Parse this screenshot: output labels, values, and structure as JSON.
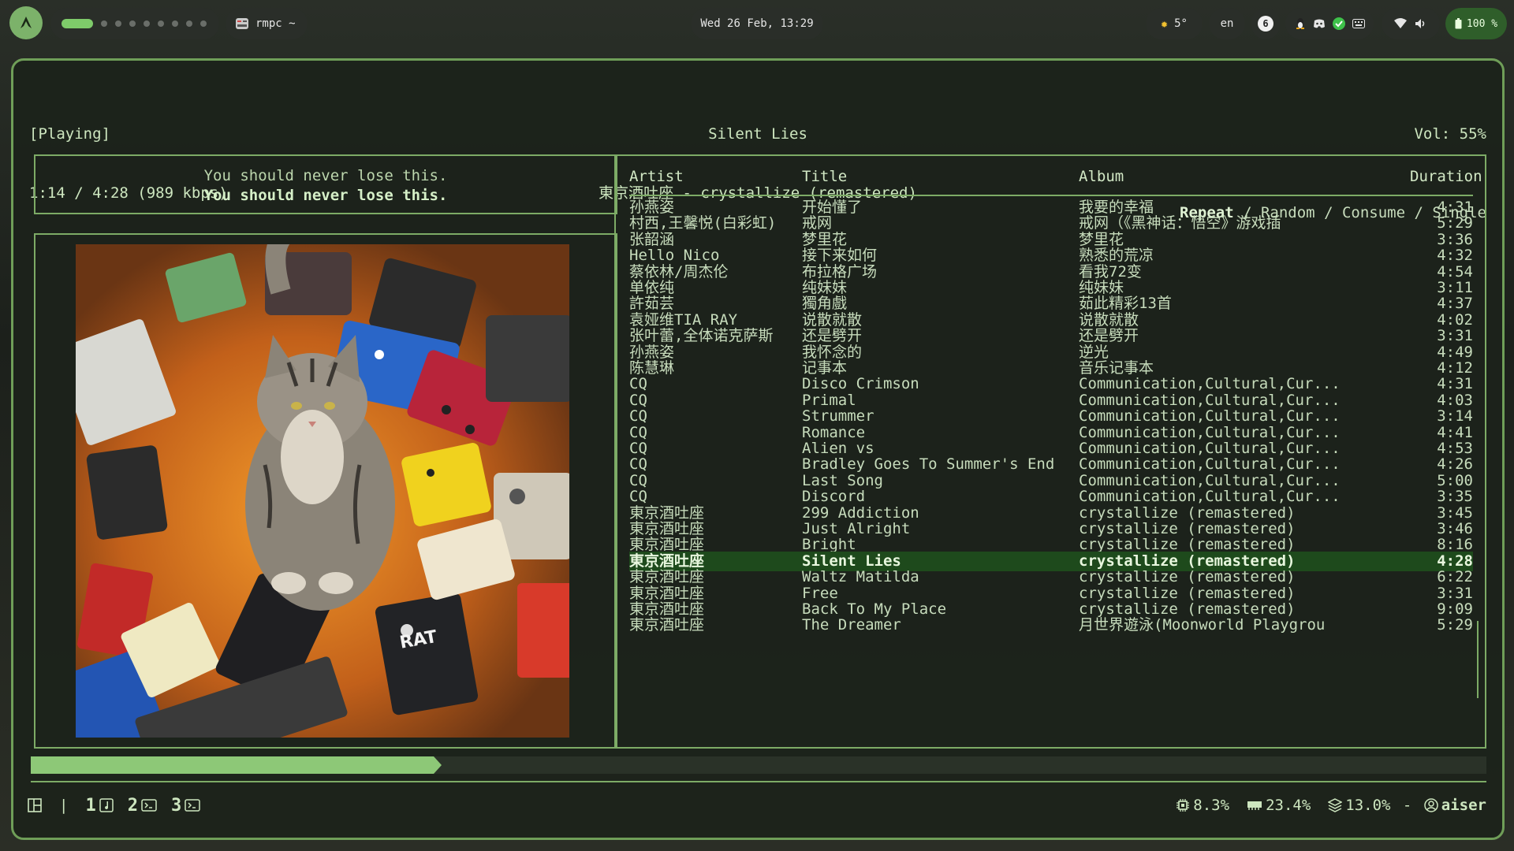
{
  "topbar": {
    "window_title": "rmpc ~",
    "clock": "Wed 26 Feb, 13:29",
    "weather": "5°",
    "lang": "en",
    "notif_count": "6",
    "battery": "100 %"
  },
  "player": {
    "state": "[Playing]",
    "time": "1:14 / 4:28 (989 kbps)",
    "song_title": "Silent Lies",
    "song_subtitle": "東京酒吐座 - crystallize (remastered)",
    "volume": "Vol: 55%",
    "modes": [
      "Repeat",
      "Random",
      "Consume",
      "Single"
    ],
    "mode_sep": " / ",
    "progress": 0.277
  },
  "lyrics": {
    "prev": "You should never lose this.",
    "current": "You should never lose this."
  },
  "queue": {
    "headers": {
      "artist": "Artist",
      "title": "Title",
      "album": "Album",
      "duration": "Duration"
    },
    "current_index": 22,
    "rows": [
      {
        "artist": "孙燕姿",
        "title": "开始懂了",
        "album": "我要的幸福",
        "duration": "4:31"
      },
      {
        "artist": "村西,王馨悦(白彩虹)",
        "title": "戒网",
        "album": "戒网（《黑神话：悟空》游戏插",
        "duration": "5:29"
      },
      {
        "artist": "张韶涵",
        "title": "梦里花",
        "album": "梦里花",
        "duration": "3:36"
      },
      {
        "artist": "Hello Nico",
        "title": "接下来如何",
        "album": "熟悉的荒凉",
        "duration": "4:32"
      },
      {
        "artist": "蔡依林/周杰伦",
        "title": "布拉格广场",
        "album": "看我72变",
        "duration": "4:54"
      },
      {
        "artist": "单依纯",
        "title": "纯妹妹",
        "album": "纯妹妹",
        "duration": "3:11"
      },
      {
        "artist": "許茹芸",
        "title": "獨角戲",
        "album": "茹此精彩13首",
        "duration": "4:37"
      },
      {
        "artist": "袁娅维TIA RAY",
        "title": "说散就散",
        "album": "说散就散",
        "duration": "4:02"
      },
      {
        "artist": "张叶蕾,全体诺克萨斯",
        "title": "还是劈开",
        "album": "还是劈开",
        "duration": "3:31"
      },
      {
        "artist": "孙燕姿",
        "title": "我怀念的",
        "album": "逆光",
        "duration": "4:49"
      },
      {
        "artist": "陈慧琳",
        "title": "记事本",
        "album": "音乐记事本",
        "duration": "4:12"
      },
      {
        "artist": "CQ",
        "title": "Disco Crimson",
        "album": "Communication,Cultural,Cur...",
        "duration": "4:31"
      },
      {
        "artist": "CQ",
        "title": "Primal",
        "album": "Communication,Cultural,Cur...",
        "duration": "4:03"
      },
      {
        "artist": "CQ",
        "title": "Strummer",
        "album": "Communication,Cultural,Cur...",
        "duration": "3:14"
      },
      {
        "artist": "CQ",
        "title": "Romance",
        "album": "Communication,Cultural,Cur...",
        "duration": "4:41"
      },
      {
        "artist": "CQ",
        "title": "Alien vs",
        "album": "Communication,Cultural,Cur...",
        "duration": "4:53"
      },
      {
        "artist": "CQ",
        "title": "Bradley Goes To Summer's End",
        "album": "Communication,Cultural,Cur...",
        "duration": "4:26"
      },
      {
        "artist": "CQ",
        "title": "Last Song",
        "album": "Communication,Cultural,Cur...",
        "duration": "5:00"
      },
      {
        "artist": "CQ",
        "title": "Discord",
        "album": "Communication,Cultural,Cur...",
        "duration": "3:35"
      },
      {
        "artist": "東京酒吐座",
        "title": "299 Addiction",
        "album": "crystallize (remastered)",
        "duration": "3:45"
      },
      {
        "artist": "東京酒吐座",
        "title": "Just Alright",
        "album": "crystallize (remastered)",
        "duration": "3:46"
      },
      {
        "artist": "東京酒吐座",
        "title": "Bright",
        "album": "crystallize (remastered)",
        "duration": "8:16"
      },
      {
        "artist": "東京酒吐座",
        "title": "Silent Lies",
        "album": "crystallize (remastered)",
        "duration": "4:28"
      },
      {
        "artist": "東京酒吐座",
        "title": "Waltz Matilda",
        "album": "crystallize (remastered)",
        "duration": "6:22"
      },
      {
        "artist": "東京酒吐座",
        "title": "Free",
        "album": "crystallize (remastered)",
        "duration": "3:31"
      },
      {
        "artist": "東京酒吐座",
        "title": "Back To My Place",
        "album": "crystallize (remastered)",
        "duration": "9:09"
      },
      {
        "artist": "東京酒吐座",
        "title": "The Dreamer",
        "album": "月世界遊泳(Moonworld Playgrou",
        "duration": "5:29"
      }
    ]
  },
  "statusbar": {
    "tabs": [
      {
        "num": "1",
        "icon": "music-note-icon"
      },
      {
        "num": "2",
        "icon": "terminal-icon"
      },
      {
        "num": "3",
        "icon": "terminal-icon"
      }
    ],
    "cpu": "8.3%",
    "mem": "23.4%",
    "disk": "13.0%",
    "dash": " - ",
    "user": "aiser"
  },
  "colors": {
    "accent": "#7dab66",
    "progress": "#8dc877",
    "highlight_row": "#1e4a1c"
  }
}
